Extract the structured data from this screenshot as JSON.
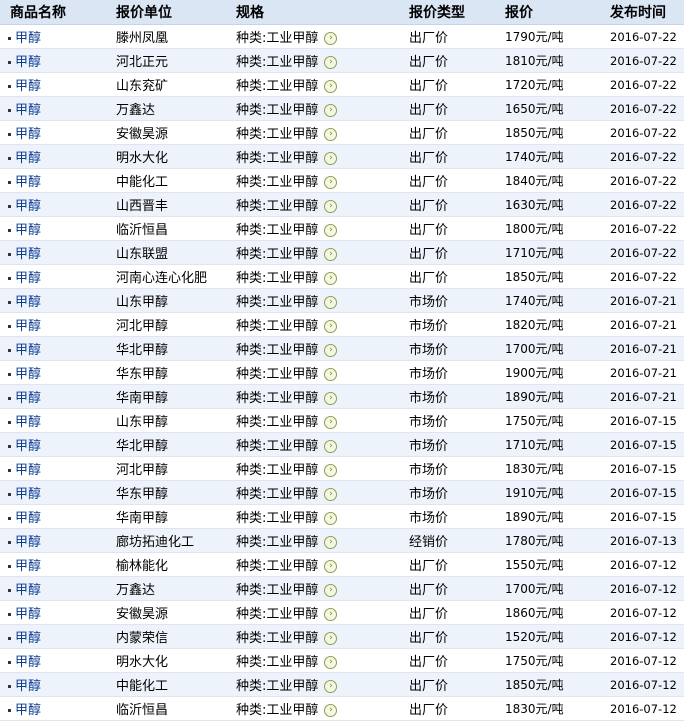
{
  "table": {
    "headers": [
      "商品名称",
      "报价单位",
      "规格",
      "报价类型",
      "报价",
      "发布时间"
    ],
    "rows": [
      {
        "name": "甲醇",
        "unit": "滕州凤凰",
        "spec": "种类:工业甲醇",
        "type": "出厂价",
        "price": "1790元/吨",
        "date": "2016-07-22"
      },
      {
        "name": "甲醇",
        "unit": "河北正元",
        "spec": "种类:工业甲醇",
        "type": "出厂价",
        "price": "1810元/吨",
        "date": "2016-07-22"
      },
      {
        "name": "甲醇",
        "unit": "山东兖矿",
        "spec": "种类:工业甲醇",
        "type": "出厂价",
        "price": "1720元/吨",
        "date": "2016-07-22"
      },
      {
        "name": "甲醇",
        "unit": "万鑫达",
        "spec": "种类:工业甲醇",
        "type": "出厂价",
        "price": "1650元/吨",
        "date": "2016-07-22"
      },
      {
        "name": "甲醇",
        "unit": "安徽昊源",
        "spec": "种类:工业甲醇",
        "type": "出厂价",
        "price": "1850元/吨",
        "date": "2016-07-22"
      },
      {
        "name": "甲醇",
        "unit": "明水大化",
        "spec": "种类:工业甲醇",
        "type": "出厂价",
        "price": "1740元/吨",
        "date": "2016-07-22"
      },
      {
        "name": "甲醇",
        "unit": "中能化工",
        "spec": "种类:工业甲醇",
        "type": "出厂价",
        "price": "1840元/吨",
        "date": "2016-07-22"
      },
      {
        "name": "甲醇",
        "unit": "山西晋丰",
        "spec": "种类:工业甲醇",
        "type": "出厂价",
        "price": "1630元/吨",
        "date": "2016-07-22"
      },
      {
        "name": "甲醇",
        "unit": "临沂恒昌",
        "spec": "种类:工业甲醇",
        "type": "出厂价",
        "price": "1800元/吨",
        "date": "2016-07-22"
      },
      {
        "name": "甲醇",
        "unit": "山东联盟",
        "spec": "种类:工业甲醇",
        "type": "出厂价",
        "price": "1710元/吨",
        "date": "2016-07-22"
      },
      {
        "name": "甲醇",
        "unit": "河南心连心化肥",
        "spec": "种类:工业甲醇",
        "type": "出厂价",
        "price": "1850元/吨",
        "date": "2016-07-22"
      },
      {
        "name": "甲醇",
        "unit": "山东甲醇",
        "spec": "种类:工业甲醇",
        "type": "市场价",
        "price": "1740元/吨",
        "date": "2016-07-21"
      },
      {
        "name": "甲醇",
        "unit": "河北甲醇",
        "spec": "种类:工业甲醇",
        "type": "市场价",
        "price": "1820元/吨",
        "date": "2016-07-21"
      },
      {
        "name": "甲醇",
        "unit": "华北甲醇",
        "spec": "种类:工业甲醇",
        "type": "市场价",
        "price": "1700元/吨",
        "date": "2016-07-21"
      },
      {
        "name": "甲醇",
        "unit": "华东甲醇",
        "spec": "种类:工业甲醇",
        "type": "市场价",
        "price": "1900元/吨",
        "date": "2016-07-21"
      },
      {
        "name": "甲醇",
        "unit": "华南甲醇",
        "spec": "种类:工业甲醇",
        "type": "市场价",
        "price": "1890元/吨",
        "date": "2016-07-21"
      },
      {
        "name": "甲醇",
        "unit": "山东甲醇",
        "spec": "种类:工业甲醇",
        "type": "市场价",
        "price": "1750元/吨",
        "date": "2016-07-15"
      },
      {
        "name": "甲醇",
        "unit": "华北甲醇",
        "spec": "种类:工业甲醇",
        "type": "市场价",
        "price": "1710元/吨",
        "date": "2016-07-15"
      },
      {
        "name": "甲醇",
        "unit": "河北甲醇",
        "spec": "种类:工业甲醇",
        "type": "市场价",
        "price": "1830元/吨",
        "date": "2016-07-15"
      },
      {
        "name": "甲醇",
        "unit": "华东甲醇",
        "spec": "种类:工业甲醇",
        "type": "市场价",
        "price": "1910元/吨",
        "date": "2016-07-15"
      },
      {
        "name": "甲醇",
        "unit": "华南甲醇",
        "spec": "种类:工业甲醇",
        "type": "市场价",
        "price": "1890元/吨",
        "date": "2016-07-15"
      },
      {
        "name": "甲醇",
        "unit": "廊坊拓迪化工",
        "spec": "种类:工业甲醇",
        "type": "经销价",
        "price": "1780元/吨",
        "date": "2016-07-13"
      },
      {
        "name": "甲醇",
        "unit": "榆林能化",
        "spec": "种类:工业甲醇",
        "type": "出厂价",
        "price": "1550元/吨",
        "date": "2016-07-12"
      },
      {
        "name": "甲醇",
        "unit": "万鑫达",
        "spec": "种类:工业甲醇",
        "type": "出厂价",
        "price": "1700元/吨",
        "date": "2016-07-12"
      },
      {
        "name": "甲醇",
        "unit": "安徽昊源",
        "spec": "种类:工业甲醇",
        "type": "出厂价",
        "price": "1860元/吨",
        "date": "2016-07-12"
      },
      {
        "name": "甲醇",
        "unit": "内蒙荣信",
        "spec": "种类:工业甲醇",
        "type": "出厂价",
        "price": "1520元/吨",
        "date": "2016-07-12"
      },
      {
        "name": "甲醇",
        "unit": "明水大化",
        "spec": "种类:工业甲醇",
        "type": "出厂价",
        "price": "1750元/吨",
        "date": "2016-07-12"
      },
      {
        "name": "甲醇",
        "unit": "中能化工",
        "spec": "种类:工业甲醇",
        "type": "出厂价",
        "price": "1850元/吨",
        "date": "2016-07-12"
      },
      {
        "name": "甲醇",
        "unit": "临沂恒昌",
        "spec": "种类:工业甲醇",
        "type": "出厂价",
        "price": "1830元/吨",
        "date": "2016-07-12"
      }
    ]
  },
  "icons": {
    "spec_arrow": "arrow-right-circle-icon",
    "bullet": "bullet-icon"
  },
  "colors": {
    "header_bg": "#dbe6f5",
    "row_alt_bg": "#eef3fb",
    "link": "#0a3d91"
  }
}
